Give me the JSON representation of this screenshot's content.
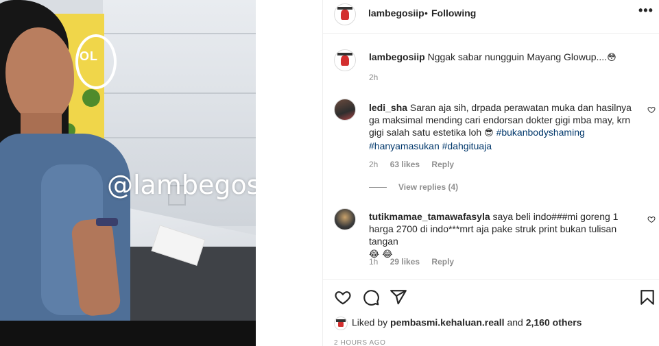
{
  "media": {
    "watermark": "@lambegosiip",
    "poster_text": "OL"
  },
  "header": {
    "username": "lambegosiip",
    "separator": "•",
    "follow_status": "Following",
    "more_label": "•••"
  },
  "caption": {
    "username": "lambegosiip",
    "text": "Nggak sabar nungguin Mayang Glowup....",
    "emoji": "😳",
    "time": "2h"
  },
  "comments": [
    {
      "username": "ledi_sha",
      "text": "Saran aja sih, drpada perawatan muka dan hasilnya ga maksimal mending cari endorsan dokter gigi mba may, krn gigi salah satu estetika loh",
      "emoji": "😎",
      "hashtags": [
        "#bukanbodyshaming",
        "#hanyamasukan",
        "#dahgituaja"
      ],
      "time": "2h",
      "likes": "63 likes",
      "reply_label": "Reply",
      "view_replies": "View replies (4)"
    },
    {
      "username": "tutikmamae_tamawafasyla",
      "text": "saya beli indo###mi goreng 1 harga 2700 di indo***mrt aja pake struk print bukan tulisan tangan",
      "emoji": "😂 😂",
      "time": "1h",
      "likes": "29 likes",
      "reply_label": "Reply"
    }
  ],
  "footer": {
    "liked_prefix": "Liked by",
    "liked_user": "pembasmi.kehaluan.reall",
    "liked_and": "and",
    "liked_count": "2,160 others",
    "timestamp": "2 HOURS AGO"
  },
  "icons": {
    "like": "heart-icon",
    "comment": "comment-icon",
    "share": "paper-plane-icon",
    "save": "bookmark-icon"
  },
  "colors": {
    "text": "#262626",
    "muted": "#8e8e8e",
    "hashtag": "#00376b",
    "border": "#efefef"
  }
}
